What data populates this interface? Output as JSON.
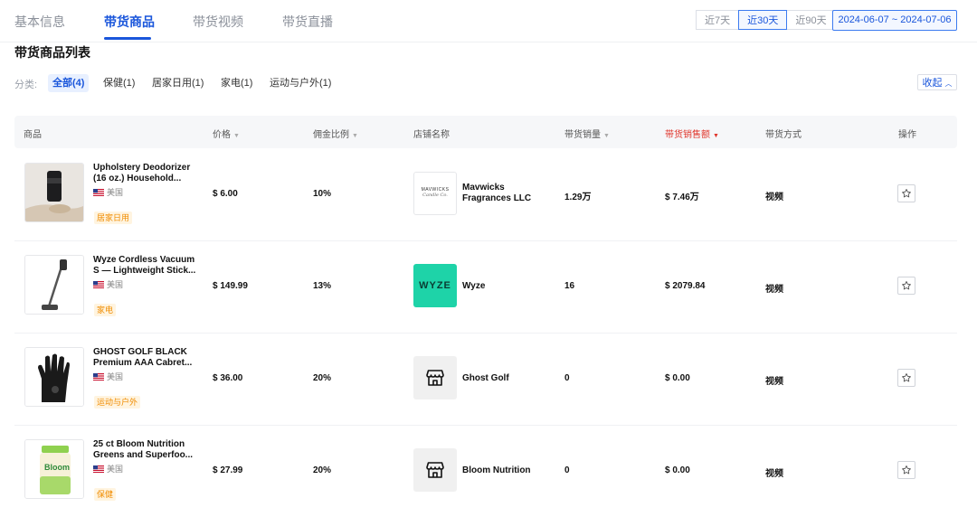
{
  "tabs": [
    {
      "label": "基本信息",
      "active": false
    },
    {
      "label": "带货商品",
      "active": true
    },
    {
      "label": "带货视频",
      "active": false
    },
    {
      "label": "带货直播",
      "active": false
    }
  ],
  "range_buttons": [
    {
      "label": "近7天",
      "active": false
    },
    {
      "label": "近30天",
      "active": true
    },
    {
      "label": "近90天",
      "active": false
    }
  ],
  "date_range": "2024-06-07 ~ 2024-07-06",
  "section_title": "带货商品列表",
  "filters": {
    "label": "分类:",
    "chips": [
      {
        "label": "全部(4)",
        "active": true
      },
      {
        "label": "保健(1)",
        "active": false
      },
      {
        "label": "居家日用(1)",
        "active": false
      },
      {
        "label": "家电(1)",
        "active": false
      },
      {
        "label": "运动与户外(1)",
        "active": false
      }
    ],
    "collapse_label": "收起"
  },
  "columns": {
    "product": "商品",
    "price": "价格",
    "commission": "佣金比例",
    "shop": "店铺名称",
    "sales": "带货销量",
    "revenue": "带货销售额",
    "method": "带货方式",
    "action": "操作"
  },
  "accent_color": "#1a56db",
  "sorted_color": "#e0352b",
  "rows": [
    {
      "name": "Upholstery Deodorizer (16 oz.) Household...",
      "origin": "美国",
      "category": "居家日用",
      "price": "$ 6.00",
      "commission": "10%",
      "shop_logo_text": "MAVWICKS",
      "shop_logo_sub": "Candle Co.",
      "shop": "Mavwicks Fragrances LLC",
      "sales": "1.29万",
      "revenue": "$ 7.46万",
      "method": "视频"
    },
    {
      "name": "Wyze Cordless Vacuum S — Lightweight Stick...",
      "origin": "美国",
      "category": "家电",
      "price": "$ 149.99",
      "commission": "13%",
      "shop_logo_text": "WYZE",
      "shop": "Wyze",
      "sales": "16",
      "revenue": "$ 2079.84",
      "method": "视频"
    },
    {
      "name": "GHOST GOLF BLACK Premium AAA Cabret...",
      "origin": "美国",
      "category": "运动与户外",
      "price": "$ 36.00",
      "commission": "20%",
      "shop": "Ghost Golf",
      "sales": "0",
      "revenue": "$ 0.00",
      "method": "视频"
    },
    {
      "name": "25 ct Bloom Nutrition Greens and Superfoo...",
      "origin": "美国",
      "category": "保健",
      "price": "$ 27.99",
      "commission": "20%",
      "product_label": "Bloom",
      "shop": "Bloom Nutrition",
      "sales": "0",
      "revenue": "$ 0.00",
      "method": "视频"
    }
  ]
}
